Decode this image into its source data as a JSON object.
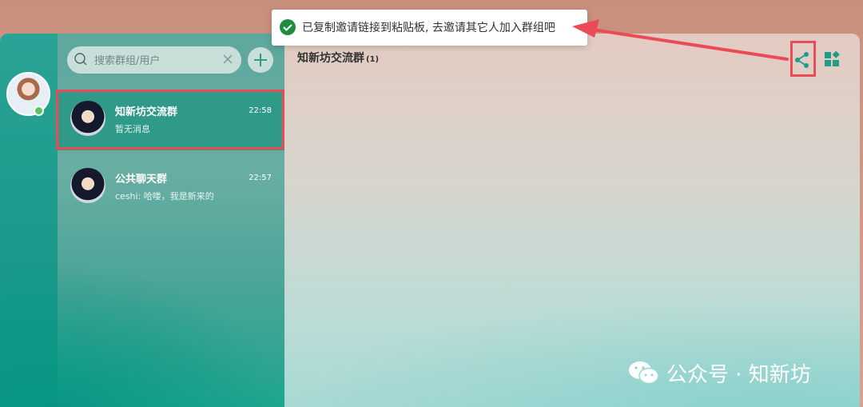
{
  "toast": {
    "message": "已复制邀请链接到粘贴板, 去邀请其它人加入群组吧",
    "icon": "check-circle-icon",
    "accent": "#1e8e3e"
  },
  "search": {
    "placeholder": "搜索群组/用户"
  },
  "conversations": [
    {
      "name": "知新坊交流群",
      "time": "22:58",
      "preview": "暂无消息",
      "active": true
    },
    {
      "name": "公共聊天群",
      "time": "22:57",
      "preview": "ceshi: 哈喽，我是新来的",
      "active": false
    }
  ],
  "chat": {
    "title": "知新坊交流群",
    "member_count": "(1)"
  },
  "header_icons": [
    "share-icon",
    "apps-icon"
  ],
  "watermark": {
    "text": "公众号 · 知新坊",
    "icon": "wechat-icon"
  },
  "colors": {
    "accent_teal": "#1f9c8a",
    "highlight_red": "#ea4b57",
    "online": "#57c45f"
  }
}
